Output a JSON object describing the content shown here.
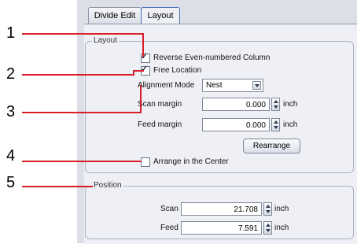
{
  "callouts": [
    "1",
    "2",
    "3",
    "4",
    "5"
  ],
  "tabs": [
    {
      "label": "Divide Edit",
      "active": false
    },
    {
      "label": "Layout",
      "active": true
    }
  ],
  "layout_group": {
    "legend": "Layout",
    "reverse_column": {
      "label": "Reverse Even-numbered Column",
      "checked": true
    },
    "free_location": {
      "label": "Free Location",
      "checked": true
    },
    "alignment_mode": {
      "label": "Alignment Mode",
      "value": "Nest"
    },
    "scan_margin": {
      "label": "Scan margin",
      "value": "0.000",
      "unit": "inch"
    },
    "feed_margin": {
      "label": "Feed margin",
      "value": "0.000",
      "unit": "inch"
    },
    "rearrange_button": "Rearrange",
    "arrange_center": {
      "label": "Arrange in the Center",
      "checked": false
    }
  },
  "position_group": {
    "legend": "Position",
    "scan": {
      "label": "Scan",
      "value": "21.708",
      "unit": "inch"
    },
    "feed": {
      "label": "Feed",
      "value": "7.591",
      "unit": "inch"
    }
  },
  "colors": {
    "callout_line": "#d81e28",
    "panel_bg": "#eef0f5"
  }
}
